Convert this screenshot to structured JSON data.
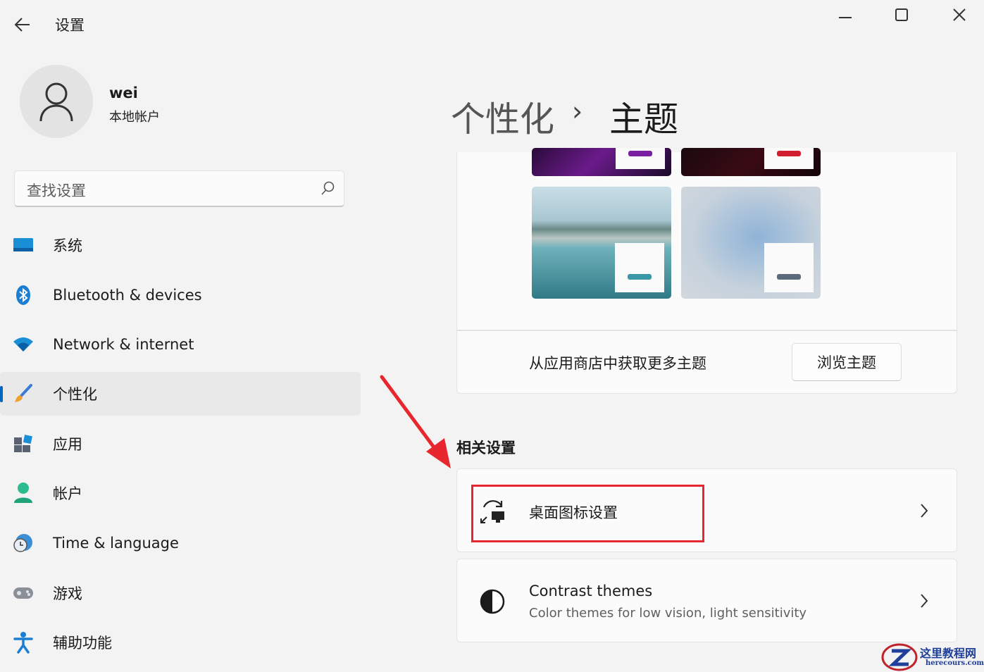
{
  "window": {
    "title": "设置",
    "controls": [
      "minimize-icon",
      "maximize-icon",
      "close-icon"
    ]
  },
  "profile": {
    "name": "wei",
    "account_type": "本地帐户"
  },
  "search": {
    "placeholder": "查找设置"
  },
  "sidebar": {
    "items": [
      {
        "label": "系统",
        "icon": "system-icon"
      },
      {
        "label": "Bluetooth & devices",
        "icon": "bluetooth-icon"
      },
      {
        "label": "Network & internet",
        "icon": "wifi-icon"
      },
      {
        "label": "个性化",
        "icon": "brush-icon",
        "selected": true
      },
      {
        "label": "应用",
        "icon": "apps-icon"
      },
      {
        "label": "帐户",
        "icon": "account-icon"
      },
      {
        "label": "Time & language",
        "icon": "clock-globe-icon"
      },
      {
        "label": "游戏",
        "icon": "gamepad-icon"
      },
      {
        "label": "辅助功能",
        "icon": "accessibility-icon"
      }
    ],
    "accent": "#0067c0"
  },
  "breadcrumb": {
    "parent": "个性化",
    "separator": "›",
    "current": "主题"
  },
  "themes": {
    "store_text": "从应用商店中获取更多主题",
    "browse_button": "浏览主题"
  },
  "related": {
    "title": "相关设置",
    "desktop_icons": {
      "label": "桌面图标设置",
      "icon": "desktop-icon-settings-icon"
    },
    "contrast": {
      "title": "Contrast themes",
      "description": "Color themes for low vision, light sensitivity",
      "icon": "contrast-icon"
    }
  },
  "annotation": {
    "highlight_color": "#e8262d"
  },
  "watermark": {
    "text": "这里教程网",
    "sub": "herecours.com"
  }
}
